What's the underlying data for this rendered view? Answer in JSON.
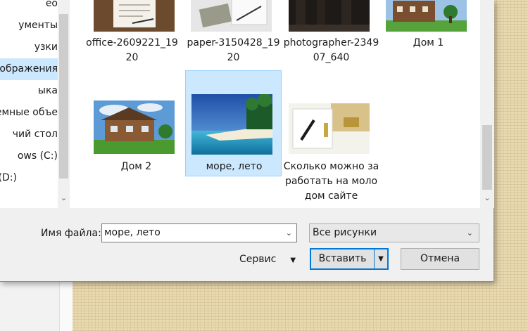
{
  "nav_pane": {
    "items": [
      {
        "label": "ео"
      },
      {
        "label": "ументы"
      },
      {
        "label": "узки"
      },
      {
        "label": "ображения",
        "selected": true
      },
      {
        "label": "ыка"
      },
      {
        "label": "емные объе"
      },
      {
        "label": "чий стол"
      },
      {
        "label": "ows (C:)"
      },
      {
        "label": "(D:)"
      }
    ]
  },
  "files": [
    {
      "name": "office-2609221_1920",
      "icon": "office-photo-thumbnail"
    },
    {
      "name": "paper-3150428_1920",
      "icon": "paper-photo-thumbnail"
    },
    {
      "name": "photographer-234907_640",
      "icon": "photographer-photo-thumbnail"
    },
    {
      "name": "Дом 1",
      "icon": "house-photo-thumbnail"
    },
    {
      "name": "Дом 2",
      "icon": "house-photo-thumbnail"
    },
    {
      "name": "море, лето",
      "icon": "beach-photo-thumbnail",
      "selected": true
    },
    {
      "name": "Сколько можно заработать на молодом сайте",
      "icon": "pen-photo-thumbnail"
    }
  ],
  "footer": {
    "filename_label": "Имя файла:",
    "filename_value": "море, лето",
    "filetype_value": "Все рисунки",
    "tools_label": "Сервис",
    "insert_label": "Вставить",
    "cancel_label": "Отмена"
  },
  "colors": {
    "selection": "#cce8ff",
    "accent": "#0078d7"
  }
}
